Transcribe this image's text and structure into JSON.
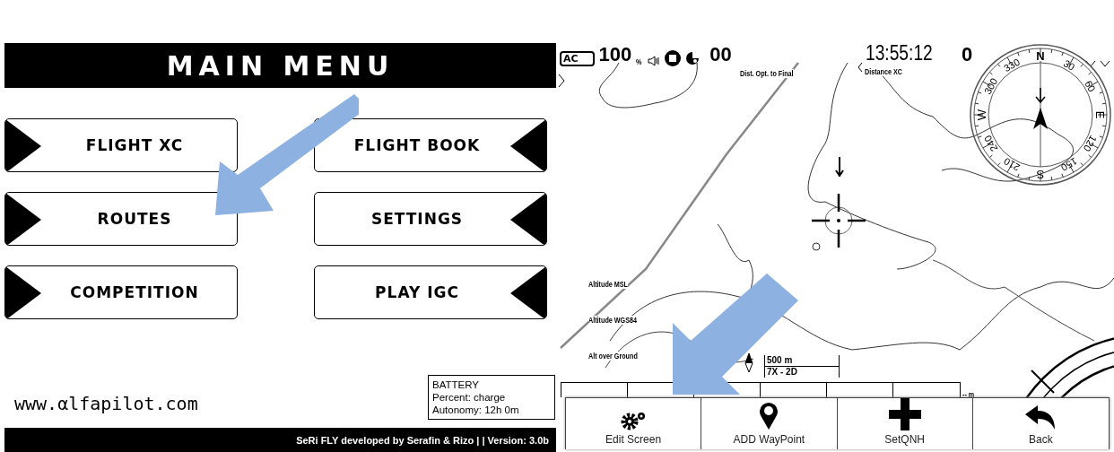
{
  "main_menu": {
    "title": "MAIN MENU",
    "buttons": [
      {
        "label": "FLIGHT XC",
        "kind": "left"
      },
      {
        "label": "FLIGHT BOOK",
        "kind": "right"
      },
      {
        "label": "ROUTES",
        "kind": "left"
      },
      {
        "label": "SETTINGS",
        "kind": "right"
      },
      {
        "label": "COMPETITION",
        "kind": "left"
      },
      {
        "label": "PLAY IGC",
        "kind": "right"
      }
    ],
    "website": "www.αlfapilot.com",
    "battery": {
      "title": "BATTERY",
      "lines": [
        "Percent: charge",
        "Autonomy: 12h 0m"
      ]
    },
    "footer": "SeRi FLY developed by Serafin & Rizo | | Version: 3.0b"
  },
  "map_screen": {
    "status": {
      "power": "AC",
      "battery_level": "100",
      "battery_unit": "%",
      "satellites": "00"
    },
    "dist_final_label": "Dist. Opt. to Final",
    "time": "13:55:12",
    "distance_label": "Distance XC",
    "distance_value": "0",
    "compass": {
      "labels": [
        "N",
        "30",
        "60",
        "E",
        "120",
        "150",
        "S",
        "210",
        "240",
        "W",
        "300",
        "330"
      ]
    },
    "altitude_labels": [
      "Altitude MSL",
      "Altitude WGS84",
      "Alt over Ground"
    ],
    "scale": {
      "distance": "500 m",
      "mode": "7X - 2D"
    },
    "bar_reading": "-- m",
    "toolbar": [
      {
        "label": "Edit Screen",
        "kind": "gears"
      },
      {
        "label": "ADD WayPoint",
        "kind": "pin"
      },
      {
        "label": "SetQNH",
        "kind": "plus"
      },
      {
        "label": "Back",
        "kind": "back"
      }
    ]
  }
}
